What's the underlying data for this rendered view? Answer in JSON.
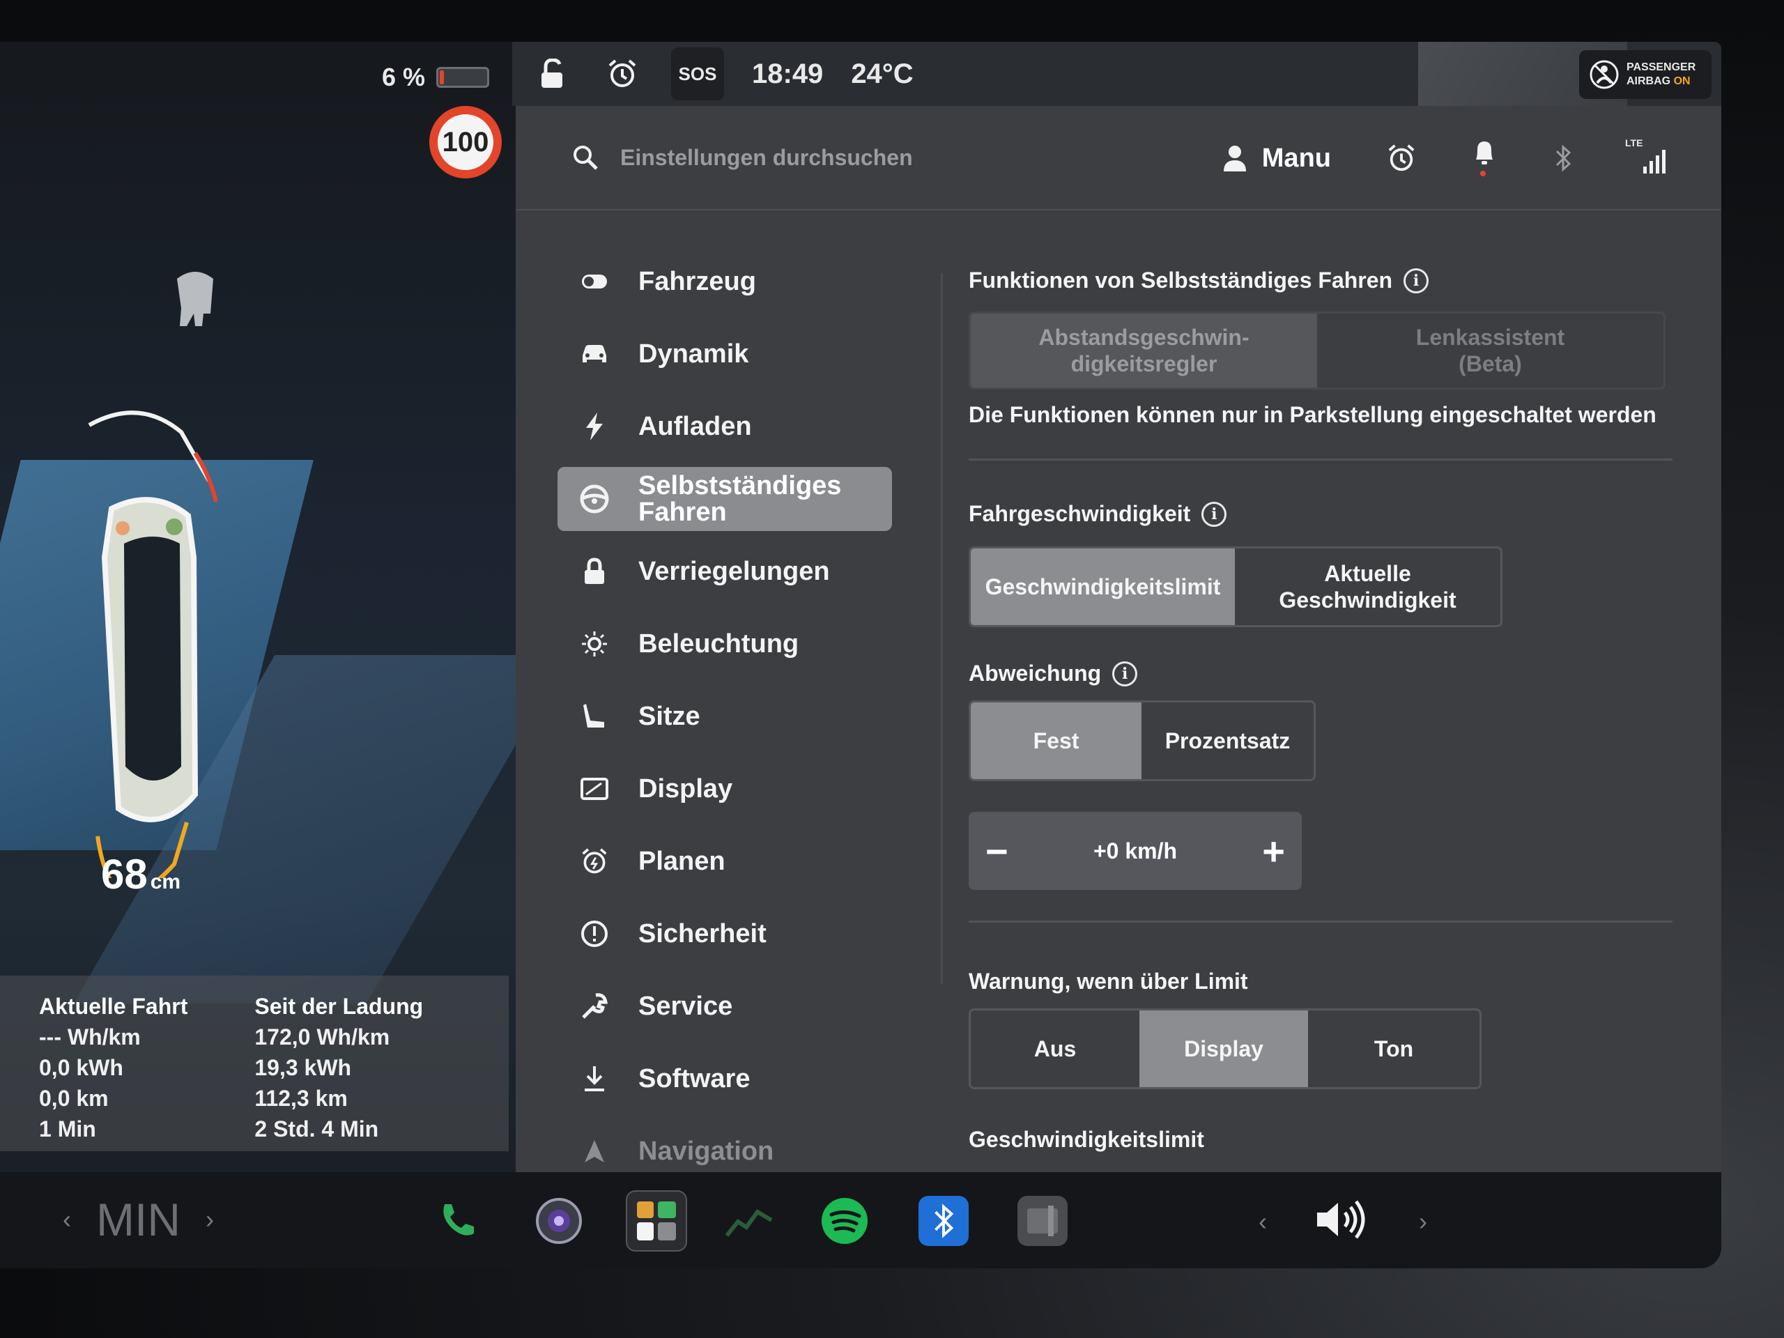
{
  "status": {
    "battery_percent": "6 %",
    "battery_level": 0.06,
    "speed_limit": "100",
    "sos_label": "SOS",
    "time": "18:49",
    "temperature": "24°C",
    "airbag_line1": "PASSENGER",
    "airbag_line2": "AIRBAG",
    "airbag_state": "ON"
  },
  "drive": {
    "distance_value": "68",
    "distance_unit": "cm"
  },
  "trip": {
    "current": {
      "title": "Aktuelle Fahrt",
      "efficiency": "--- Wh/km",
      "energy": "0,0 kWh",
      "distance": "0,0 km",
      "duration": "1 Min"
    },
    "since_charge": {
      "title": "Seit der Ladung",
      "efficiency": "172,0 Wh/km",
      "energy": "19,3 kWh",
      "distance": "112,3 km",
      "duration": "2 Std. 4 Min"
    }
  },
  "search": {
    "placeholder": "Einstellungen durchsuchen"
  },
  "user": {
    "name": "Manu"
  },
  "signal_label": "LTE",
  "sidebar": {
    "items": [
      {
        "label": "Fahrzeug",
        "icon": "toggle-icon"
      },
      {
        "label": "Dynamik",
        "icon": "car-icon"
      },
      {
        "label": "Aufladen",
        "icon": "bolt-icon"
      },
      {
        "label": "Selbstständiges Fahren",
        "icon": "steering-wheel-icon",
        "active": true
      },
      {
        "label": "Verriegelungen",
        "icon": "lock-icon"
      },
      {
        "label": "Beleuchtung",
        "icon": "sun-icon"
      },
      {
        "label": "Sitze",
        "icon": "seat-icon"
      },
      {
        "label": "Display",
        "icon": "display-icon"
      },
      {
        "label": "Planen",
        "icon": "alarm-clock-icon"
      },
      {
        "label": "Sicherheit",
        "icon": "alert-circle-icon"
      },
      {
        "label": "Service",
        "icon": "wrench-icon"
      },
      {
        "label": "Software",
        "icon": "download-icon"
      },
      {
        "label": "Navigation",
        "icon": "navigation-arrow-icon"
      }
    ]
  },
  "content": {
    "autopilot": {
      "heading": "Funktionen von Selbstständiges Fahren",
      "options": [
        "Abstandsgeschwin-digkeitsregler",
        "Lenkassistent (Beta)"
      ],
      "options_line1": [
        "Abstandsgeschwin-",
        "Lenkassistent"
      ],
      "options_line2": [
        "digkeitsregler",
        "(Beta)"
      ],
      "note": "Die Funktionen können nur in Parkstellung eingeschaltet werden"
    },
    "speed": {
      "heading": "Fahrgeschwindigkeit",
      "options": [
        "Geschwindigkeitslimit",
        "Aktuelle Geschwindigkeit"
      ],
      "option2_line1": "Aktuelle",
      "option2_line2": "Geschwindigkeit",
      "selected": "Geschwindigkeitslimit"
    },
    "offset": {
      "heading": "Abweichung",
      "options": [
        "Fest",
        "Prozentsatz"
      ],
      "selected": "Fest",
      "value": "+0 km/h",
      "minus": "−",
      "plus": "+"
    },
    "warning": {
      "heading": "Warnung, wenn über Limit",
      "options": [
        "Aus",
        "Display",
        "Ton"
      ],
      "selected": "Display"
    },
    "limit": {
      "heading": "Geschwindigkeitslimit"
    }
  },
  "dock": {
    "temperature": "MIN"
  },
  "colors": {
    "accent_red": "#e2452a",
    "selected_segment": "#8b8d91",
    "panel_bg": "#3c3e42",
    "airbag_on": "#f2a81c"
  }
}
